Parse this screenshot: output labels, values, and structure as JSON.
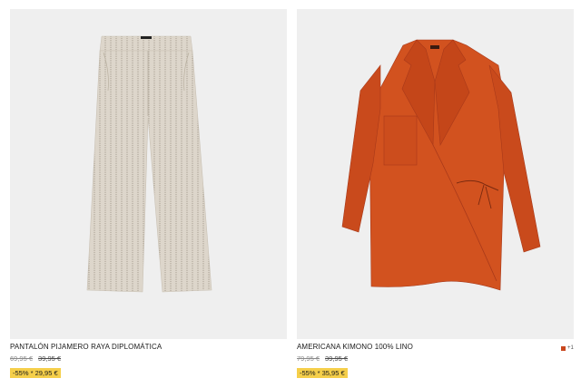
{
  "products": [
    {
      "name": "PANTALÓN PIJAMERO RAYA DIPLOMÁTICA",
      "price_original": "69,95 €",
      "price_previous": "39,95 €",
      "sale_label": "-55% * 29,95 €",
      "image_icon": "striped-linen-trousers"
    },
    {
      "name": "AMERICANA KIMONO 100% LINO",
      "price_original": "79,95 €",
      "price_previous": "39,95 €",
      "sale_label": "-55% * 35,95 €",
      "image_icon": "orange-kimono-blazer",
      "more_colors": "+1",
      "swatch_color": "#c9471e"
    }
  ],
  "colors": {
    "sale_badge": "#f5cf4a",
    "photo_background": "#efefef"
  }
}
